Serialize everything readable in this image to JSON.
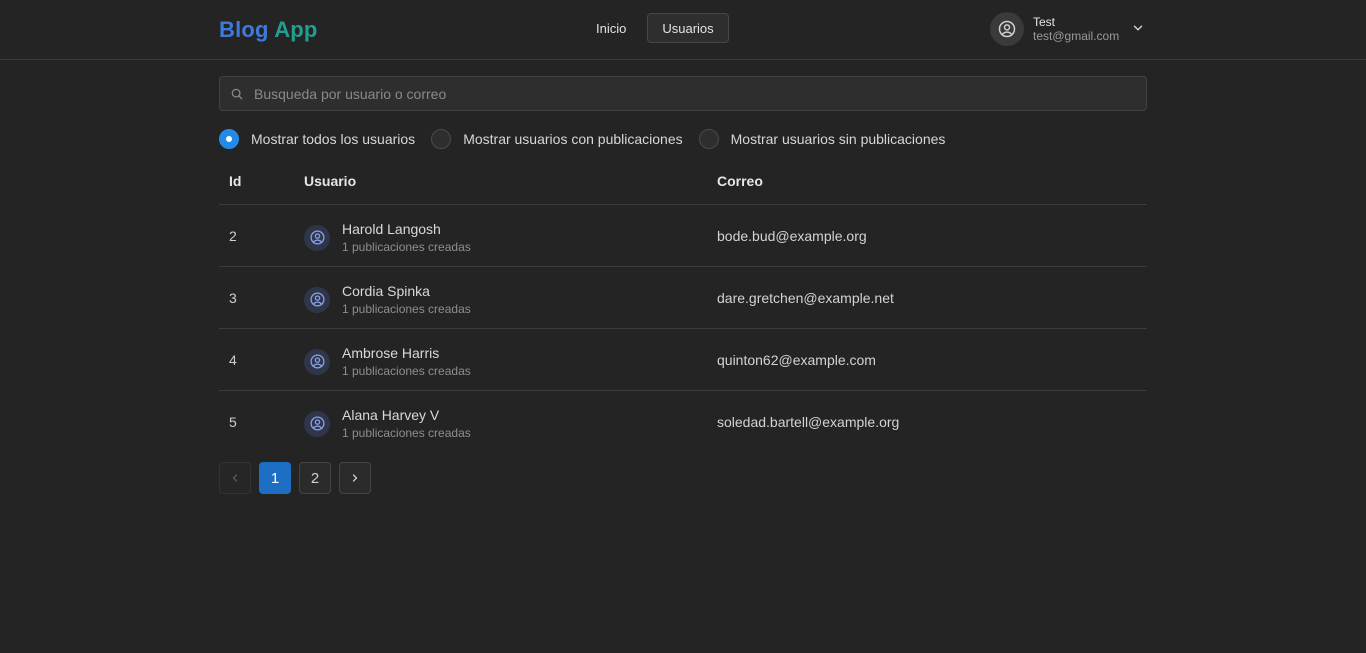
{
  "header": {
    "brand_part1": "Blog",
    "brand_part2": "App",
    "nav": [
      {
        "label": "Inicio",
        "active": false
      },
      {
        "label": "Usuarios",
        "active": true
      }
    ],
    "user": {
      "name": "Test",
      "email": "test@gmail.com"
    }
  },
  "search": {
    "placeholder": "Busqueda por usuario o correo",
    "value": ""
  },
  "filters": [
    {
      "label": "Mostrar todos los usuarios",
      "checked": true
    },
    {
      "label": "Mostrar usuarios con publicaciones",
      "checked": false
    },
    {
      "label": "Mostrar usuarios sin publicaciones",
      "checked": false
    }
  ],
  "table": {
    "columns": {
      "id": "Id",
      "user": "Usuario",
      "email": "Correo"
    },
    "rows": [
      {
        "id": "2",
        "name": "Harold Langosh",
        "posts": "1 publicaciones creadas",
        "email": "bode.bud@example.org"
      },
      {
        "id": "3",
        "name": "Cordia Spinka",
        "posts": "1 publicaciones creadas",
        "email": "dare.gretchen@example.net"
      },
      {
        "id": "4",
        "name": "Ambrose Harris",
        "posts": "1 publicaciones creadas",
        "email": "quinton62@example.com"
      },
      {
        "id": "5",
        "name": "Alana Harvey V",
        "posts": "1 publicaciones creadas",
        "email": "soledad.bartell@example.org"
      }
    ]
  },
  "pagination": {
    "pages": [
      "1",
      "2"
    ],
    "current": "1"
  },
  "colors": {
    "accent": "#228be6",
    "brand_blue": "#3d7ad9",
    "brand_teal": "#1fa08f"
  }
}
